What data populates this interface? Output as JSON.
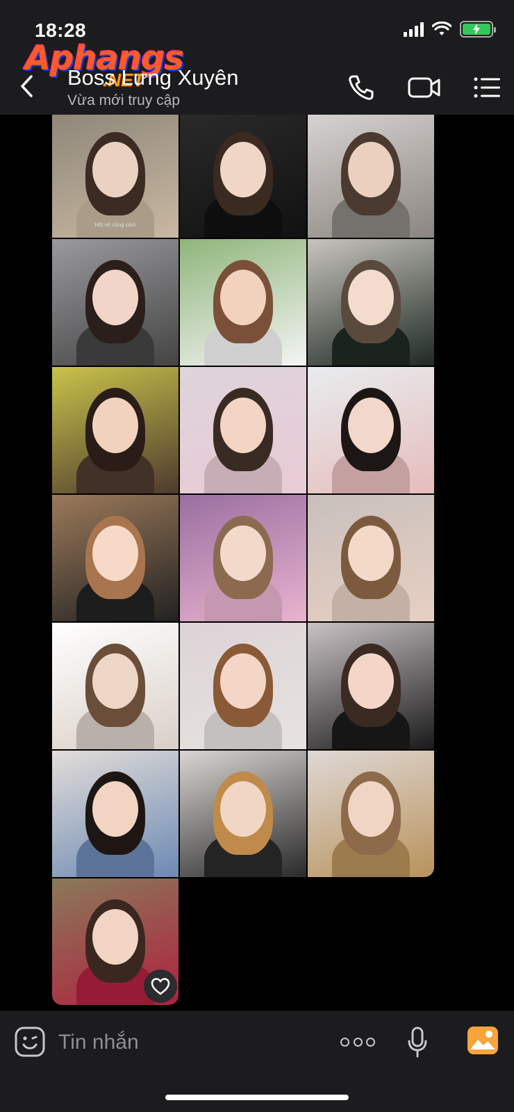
{
  "status_bar": {
    "time": "18:28",
    "battery_state": "charging"
  },
  "watermark": {
    "main": "Aphangs",
    "sub": ".NET"
  },
  "header": {
    "contact_name": "Boss Lưng Xuyên",
    "status": "Vừa mới truy cập",
    "icons": [
      "chevron-left-icon",
      "phone-icon",
      "video-call-icon",
      "list-menu-icon"
    ]
  },
  "gallery": {
    "photos": [
      {
        "caption": "Hôi về cũng cảm"
      },
      {
        "caption": ""
      },
      {
        "caption": ""
      },
      {
        "caption": ""
      },
      {
        "caption": ""
      },
      {
        "caption": ""
      },
      {
        "caption": ""
      },
      {
        "caption": ""
      },
      {
        "caption": ""
      },
      {
        "caption": ""
      },
      {
        "caption": ""
      },
      {
        "caption": ""
      },
      {
        "caption": ""
      },
      {
        "caption": ""
      },
      {
        "caption": ""
      },
      {
        "caption": ""
      },
      {
        "caption": ""
      },
      {
        "caption": ""
      },
      {
        "caption": ""
      }
    ]
  },
  "input_bar": {
    "placeholder": "Tin nhắn",
    "icons": [
      "emoji-icon",
      "more-icon",
      "microphone-icon",
      "photo-icon"
    ]
  },
  "colors": {
    "header_bg": "#1c1c1e",
    "accent_photo": "#f7a43a",
    "battery": "#34c759"
  }
}
